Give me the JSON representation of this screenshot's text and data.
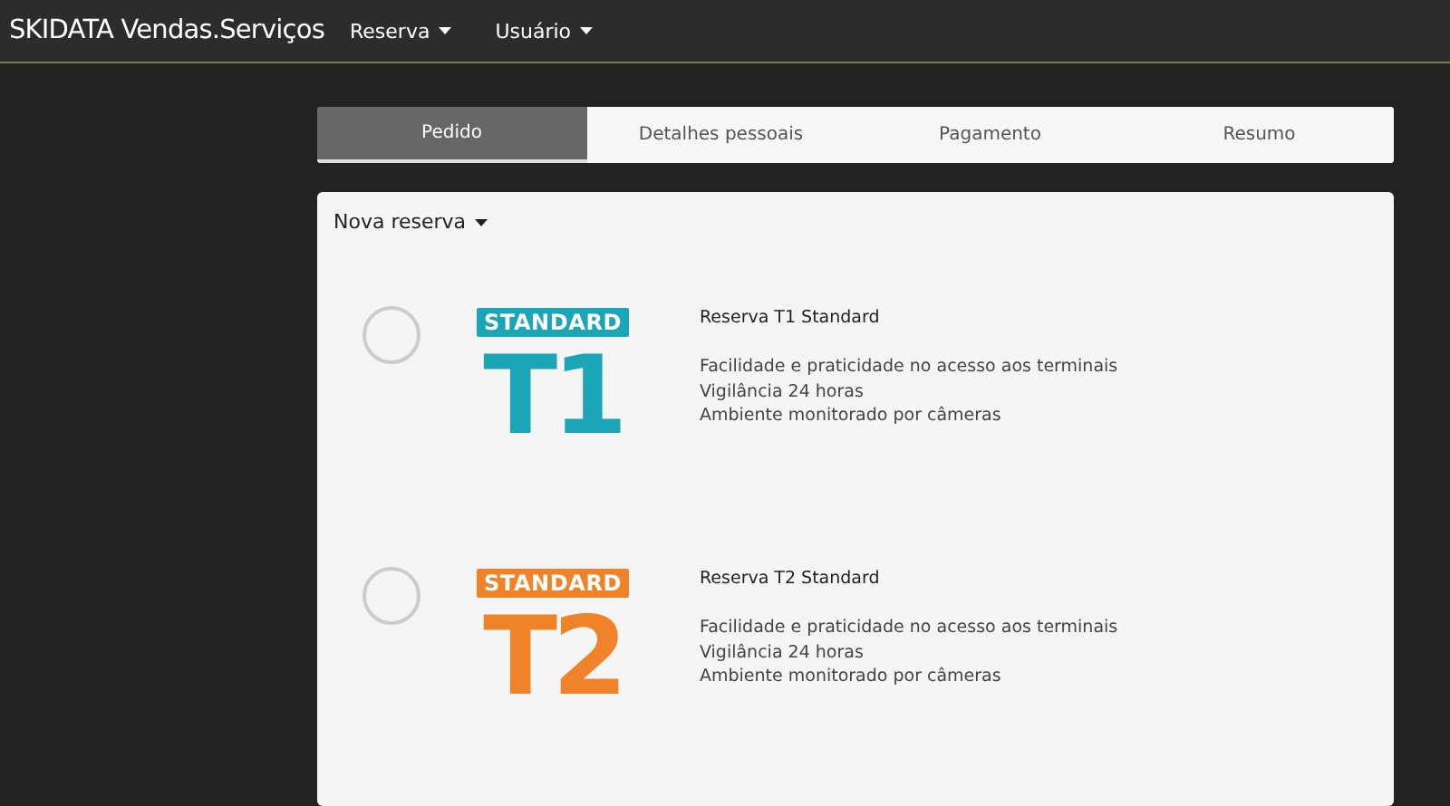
{
  "navbar": {
    "brand": "SKIDATA Vendas.Serviços",
    "menus": [
      {
        "label": "Reserva"
      },
      {
        "label": "Usuário"
      }
    ]
  },
  "steps": [
    {
      "label": "Pedido",
      "selected": true
    },
    {
      "label": "Detalhes pessoais",
      "selected": false
    },
    {
      "label": "Pagamento",
      "selected": false
    },
    {
      "label": "Resumo",
      "selected": false
    }
  ],
  "card": {
    "dropdown": "Nova reserva",
    "options": [
      {
        "selected": false,
        "color": "#1aa6b7",
        "badge": "STANDARD",
        "code": "T1",
        "title": "Reserva T1 Standard",
        "features": [
          "Facilidade e praticidade no acesso aos terminais",
          "Vigilância 24 horas",
          "Ambiente monitorado por câmeras"
        ]
      },
      {
        "selected": false,
        "color": "#f0832a",
        "badge": "STANDARD",
        "code": "T2",
        "title": "Reserva T2 Standard",
        "features": [
          "Facilidade e praticidade no acesso aos terminais",
          "Vigilância 24 horas",
          "Ambiente monitorado por câmeras"
        ]
      }
    ]
  }
}
